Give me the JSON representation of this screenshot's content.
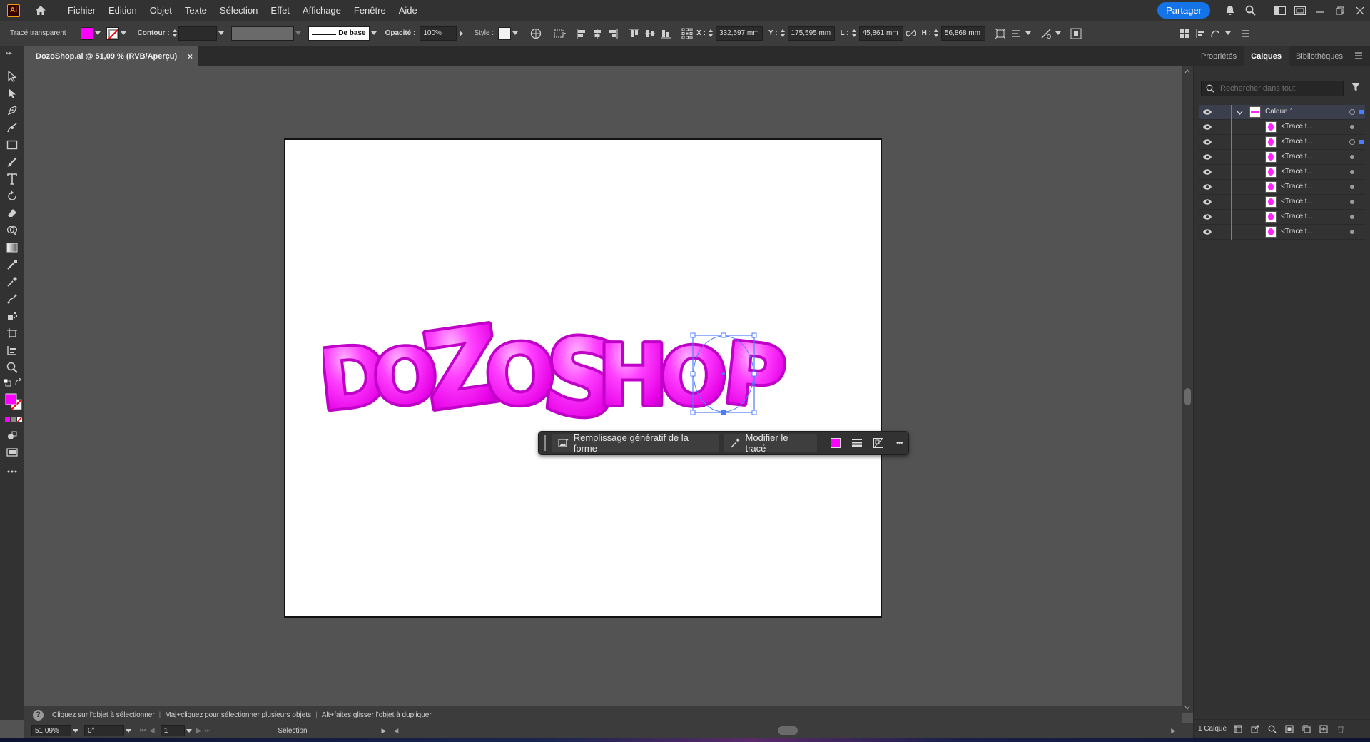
{
  "app": {
    "logo_text": "Ai"
  },
  "menus": [
    "Fichier",
    "Edition",
    "Objet",
    "Texte",
    "Sélection",
    "Effet",
    "Affichage",
    "Fenêtre",
    "Aide"
  ],
  "menubar_right": {
    "share_label": "Partager"
  },
  "control_bar": {
    "selection_type": "Tracé transparent",
    "fill_color": "#ff00ff",
    "stroke_label": "Contour :",
    "stroke_style": "De base",
    "opacity_label": "Opacité :",
    "opacity_value": "100%",
    "style_label": "Style :",
    "x_label": "X :",
    "x_value": "332,597 mm",
    "y_label": "Y :",
    "y_value": "175,595 mm",
    "w_label": "L :",
    "w_value": "45,861 mm",
    "h_label": "H :",
    "h_value": "56,868 mm"
  },
  "document": {
    "tab_title": "DozoShop.ai @ 51,09 % (RVB/Aperçu)",
    "close_glyph": "×"
  },
  "artwork": {
    "letters": [
      "D",
      "O",
      "Z",
      "O",
      "S",
      "H",
      "O",
      "P"
    ],
    "fill_color": "#ff22ff"
  },
  "taskbar": {
    "generative_fill_label": "Remplissage génératif de la forme",
    "modify_path_label": "Modifier le tracé",
    "more_glyph": "•••"
  },
  "statusbar": {
    "hint_1": "Cliquez sur l'objet à sélectionner",
    "hint_2": "Maj+cliquez pour sélectionner plusieurs objets",
    "hint_3": "Alt+faites glisser l'objet à dupliquer",
    "separator": "|",
    "help_glyph": "?"
  },
  "bottombar": {
    "zoom": "51,09%",
    "rotation": "0°",
    "artboard_index": "1",
    "tool_name": "Sélection"
  },
  "right_panel": {
    "tabs": [
      "Propriétés",
      "Calques",
      "Bibliothèques"
    ],
    "active_tab": 1,
    "search_placeholder": "Rechercher dans tout",
    "main_layer": "Calque 1",
    "sublayers": [
      "<Tracé t...",
      "<Tracé t...",
      "<Tracé t...",
      "<Tracé t...",
      "<Tracé t...",
      "<Tracé t...",
      "<Tracé t...",
      "<Tracé t..."
    ],
    "footer_label": "1 Calque",
    "accent_color": "#4d7cff"
  }
}
